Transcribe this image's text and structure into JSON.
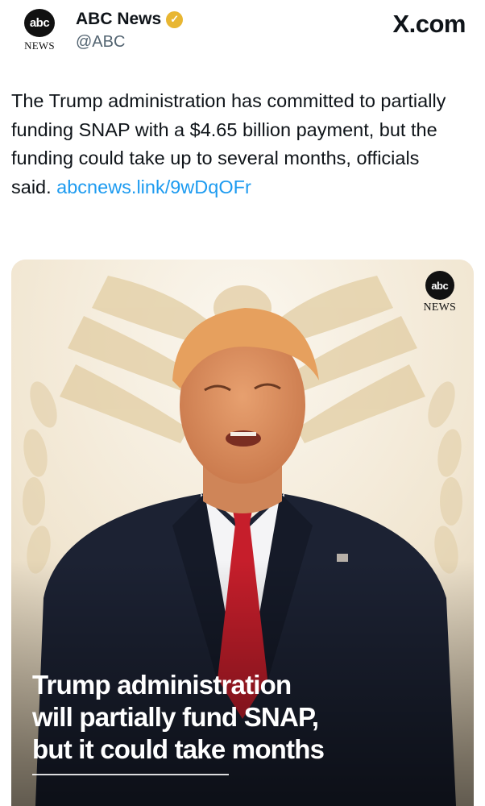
{
  "header": {
    "avatar_logo": "abc",
    "avatar_caption": "NEWS",
    "display_name": "ABC News",
    "verified_icon": "verified-badge-icon",
    "verified_color": "#e8b632",
    "handle": "@ABC",
    "site_brand": "X.com"
  },
  "tweet": {
    "text": "The Trump administration has committed to partially funding SNAP with a $4.65 billion payment, but the funding could take up to several months, officials said. ",
    "link": "abcnews.link/9wDqOFr",
    "link_color": "#1d9bf0"
  },
  "media": {
    "logo": "abc",
    "logo_caption": "NEWS",
    "headline_line1": "Trump administration",
    "headline_line2": "will partially fund SNAP,",
    "headline_line3": "but it could take months"
  }
}
